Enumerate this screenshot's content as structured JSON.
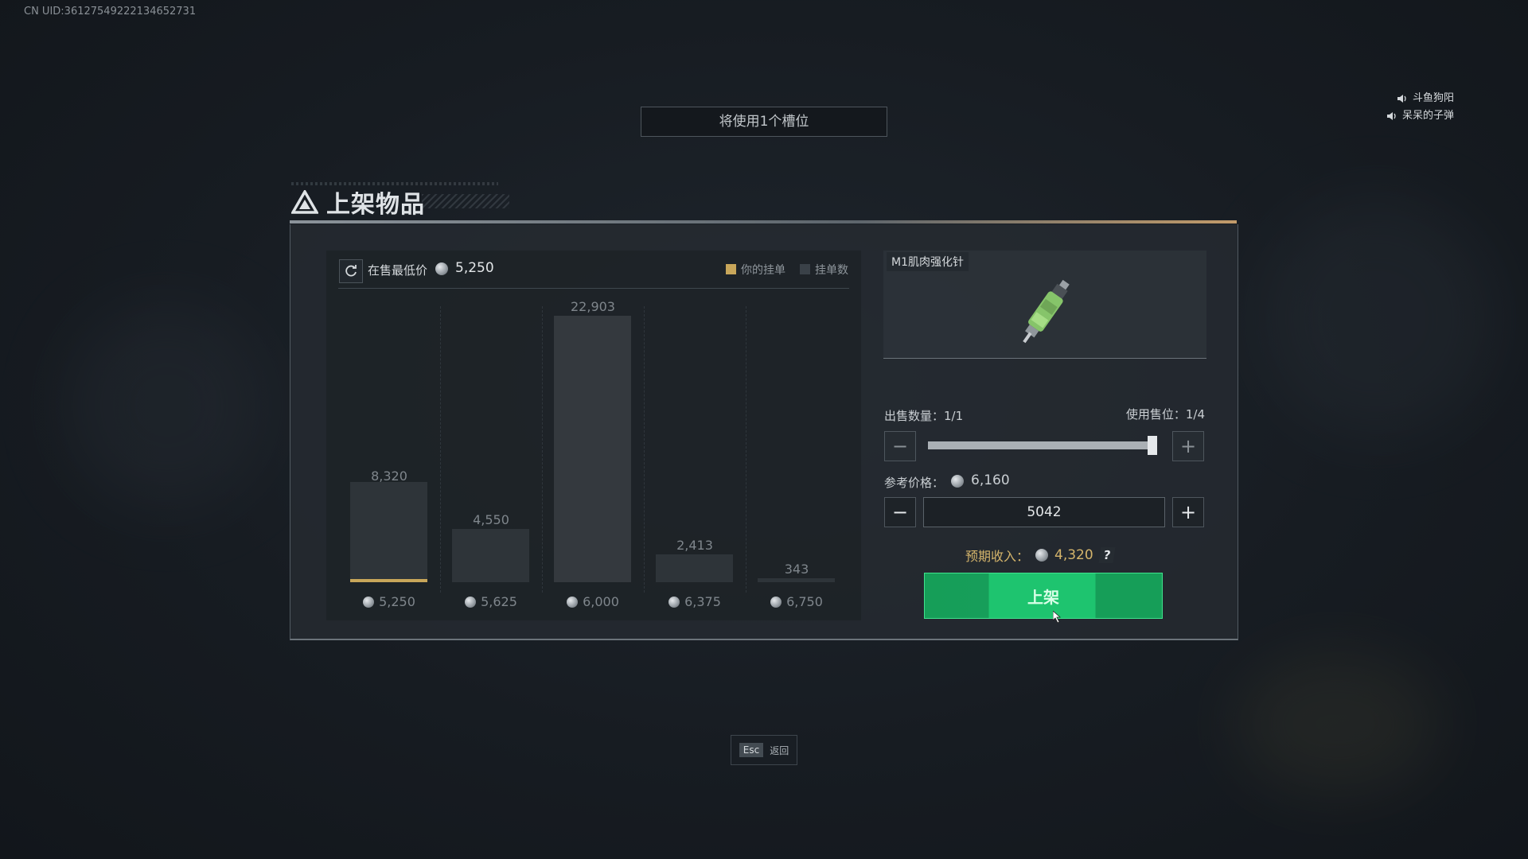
{
  "uid_text": "CN UID:3612754922213465​2731",
  "voice_chat": [
    {
      "name": "斗鱼狗阳"
    },
    {
      "name": "呆呆的子弹"
    }
  ],
  "slot_banner": "将使用1个槽位",
  "panel_title": "上架物品",
  "chart_header": {
    "lowest_label": "在售最低价",
    "lowest_value": "5,250",
    "legend": [
      {
        "label": "你的挂单",
        "color": "#c8a65a"
      },
      {
        "label": "挂单数",
        "color": "#3a4148"
      }
    ]
  },
  "chart_data": {
    "type": "bar",
    "categories": [
      "5,250",
      "5,625",
      "6,000",
      "6,375",
      "6,750"
    ],
    "values": [
      8320,
      4550,
      22903,
      2413,
      343
    ],
    "value_labels": [
      "8,320",
      "4,550",
      "22,903",
      "2,413",
      "343"
    ],
    "highlight_index": 0,
    "ylim": [
      0,
      22903
    ]
  },
  "item": {
    "name": "M1肌肉强化针",
    "icon": "syringe-icon"
  },
  "sale": {
    "qty_label": "出售数量：",
    "qty_value": "1/1",
    "slot_label": "使用售位：",
    "slot_value": "1/4",
    "qty_fraction": 1.0,
    "ref_label": "参考价格：",
    "ref_value": "6,160",
    "price_input": "5042",
    "income_label": "预期收入：",
    "income_value": "4,320",
    "help_glyph": "?",
    "list_button": "上架"
  },
  "footer": {
    "esc_key": "Esc",
    "esc_label": "返回"
  },
  "colors": {
    "accent_green": "#1ec46f",
    "gold": "#d4b46b"
  }
}
